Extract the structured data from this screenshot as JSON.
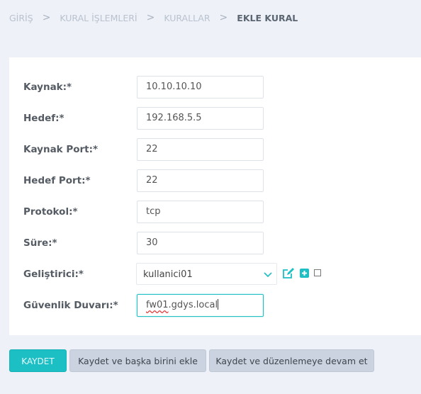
{
  "breadcrumb": {
    "items": [
      "GİRİŞ",
      "KURAL İŞLEMLERİ",
      "KURALLAR"
    ],
    "current": "EKLE KURAL",
    "separator": ">"
  },
  "form": {
    "source": {
      "label": "Kaynak:*",
      "value": "10.10.10.10"
    },
    "destination": {
      "label": "Hedef:*",
      "value": "192.168.5.5"
    },
    "source_port": {
      "label": "Kaynak Port:*",
      "value": "22"
    },
    "destination_port": {
      "label": "Hedef Port:*",
      "value": "22"
    },
    "protocol": {
      "label": "Protokol:*",
      "value": "tcp"
    },
    "duration": {
      "label": "Süre:*",
      "value": "30"
    },
    "developer": {
      "label": "Geliştirici:*",
      "value": "kullanici01"
    },
    "firewall": {
      "label": "Güvenlik Duvarı:*",
      "value_prefix": "fw01",
      "value_suffix": ".gdys.local"
    }
  },
  "actions": {
    "save": "KAYDET",
    "save_and_add": "Kaydet ve başka birini ekle",
    "save_and_continue": "Kaydet ve düzenlemeye devam et"
  },
  "icons": {
    "edit": "edit-icon",
    "add": "add-icon",
    "checkbox": "checkbox-icon",
    "dropdown": "chevron-down-icon"
  },
  "colors": {
    "accent": "#1bbfc4",
    "background": "#eef1f7",
    "secondary_button": "#cad3df"
  }
}
